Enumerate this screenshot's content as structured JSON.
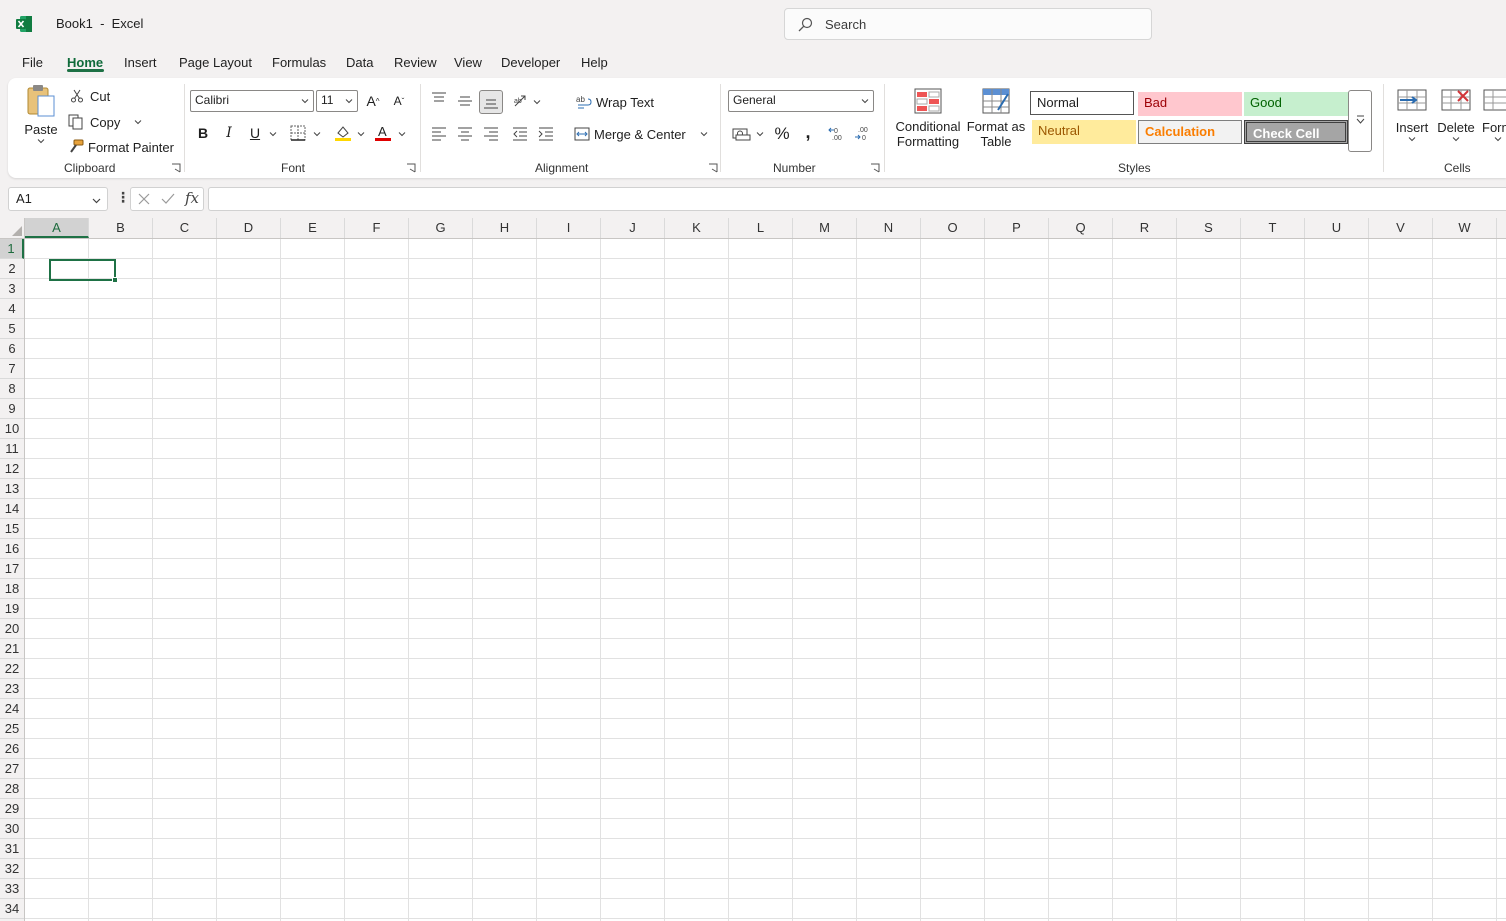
{
  "titlebar": {
    "doc_title": "Book1  -  Excel",
    "search_placeholder": "Search"
  },
  "menu": {
    "tabs": [
      "File",
      "Home",
      "Insert",
      "Page Layout",
      "Formulas",
      "Data",
      "Review",
      "View",
      "Developer",
      "Help"
    ],
    "active_tab": "Home"
  },
  "ribbon": {
    "clipboard": {
      "paste": "Paste",
      "cut": "Cut",
      "copy": "Copy",
      "format_painter": "Format Painter",
      "label": "Clipboard"
    },
    "font": {
      "font_name": "Calibri",
      "font_size": "11",
      "bold": "B",
      "italic": "I",
      "underline": "U",
      "label": "Font",
      "fill_color": "#ffd700",
      "font_color": "#e00000"
    },
    "alignment": {
      "wrap_text": "Wrap Text",
      "merge_center": "Merge & Center",
      "label": "Alignment"
    },
    "number": {
      "format": "General",
      "label": "Number"
    },
    "styles": {
      "conditional_formatting_1": "Conditional",
      "conditional_formatting_2": "Formatting",
      "format_as_table_1": "Format as",
      "format_as_table_2": "Table",
      "normal": "Normal",
      "bad": "Bad",
      "good": "Good",
      "neutral": "Neutral",
      "calculation": "Calculation",
      "check_cell": "Check Cell",
      "label": "Styles"
    },
    "cells": {
      "insert": "Insert",
      "delete": "Delete",
      "format": "Form",
      "label": "Cells"
    }
  },
  "formula_bar": {
    "name_box": "A1",
    "dots": "⋮",
    "fx": "fx",
    "formula": ""
  },
  "grid": {
    "columns": [
      "A",
      "B",
      "C",
      "D",
      "E",
      "F",
      "G",
      "H",
      "I",
      "J",
      "K",
      "L",
      "M",
      "N",
      "O",
      "P",
      "Q",
      "R",
      "S",
      "T",
      "U",
      "V",
      "W"
    ],
    "rows": [
      "1",
      "2",
      "3",
      "4",
      "5",
      "6",
      "7",
      "8",
      "9",
      "10",
      "11",
      "12",
      "13",
      "14",
      "15",
      "16",
      "17",
      "18",
      "19",
      "20",
      "21",
      "22",
      "23",
      "24",
      "25",
      "26",
      "27",
      "28",
      "29",
      "30",
      "31",
      "32",
      "33",
      "34"
    ],
    "active_cell": "A1"
  },
  "colors": {
    "accent": "#1e7145"
  }
}
